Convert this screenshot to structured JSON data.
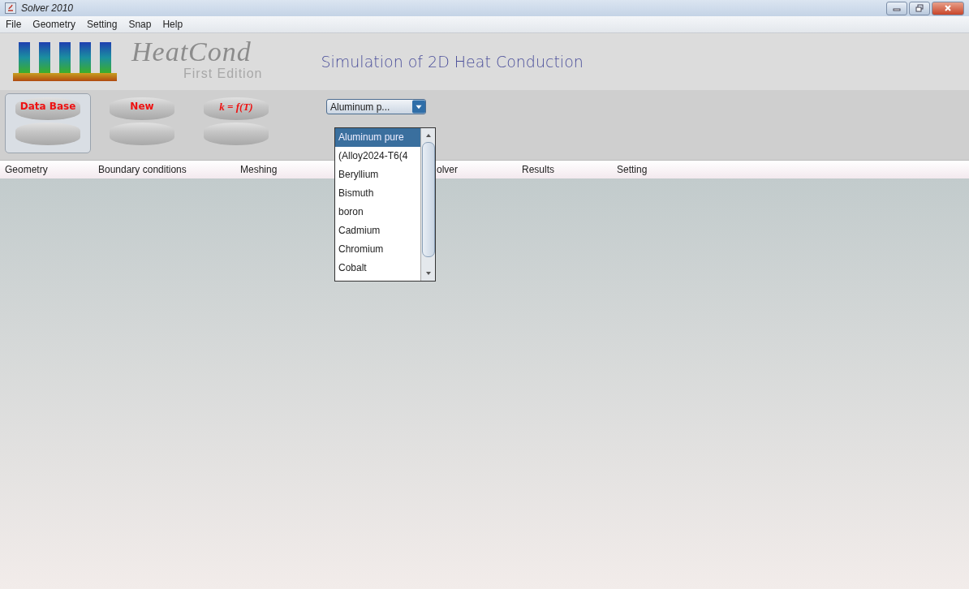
{
  "window": {
    "title": "Solver 2010"
  },
  "menu": [
    "File",
    "Geometry",
    "Setting",
    "Snap",
    "Help"
  ],
  "banner": {
    "logo": "HeatCond",
    "edition": "First Edition",
    "subtitle": "Simulation of 2D Heat Conduction"
  },
  "toolbar": [
    {
      "label": "Data Base",
      "selected": true,
      "kind": "text"
    },
    {
      "label": "New",
      "selected": false,
      "kind": "text"
    },
    {
      "label": "k = f(T)",
      "selected": false,
      "kind": "formula"
    }
  ],
  "material_combo": {
    "value": "Aluminum p...",
    "options": [
      {
        "label": "Aluminum pure",
        "selected": true
      },
      {
        "label": "(Alloy2024-T6(4",
        "selected": false
      },
      {
        "label": "Beryllium",
        "selected": false
      },
      {
        "label": "Bismuth",
        "selected": false
      },
      {
        "label": "boron",
        "selected": false
      },
      {
        "label": "Cadmium",
        "selected": false
      },
      {
        "label": "Chromium",
        "selected": false
      },
      {
        "label": "Cobalt",
        "selected": false
      }
    ]
  },
  "tabs": [
    {
      "label": "Geometry"
    },
    {
      "label": "Boundary conditions"
    },
    {
      "label": "Meshing"
    },
    {
      "label": "olver"
    },
    {
      "label": "Results"
    },
    {
      "label": "Setting"
    }
  ]
}
